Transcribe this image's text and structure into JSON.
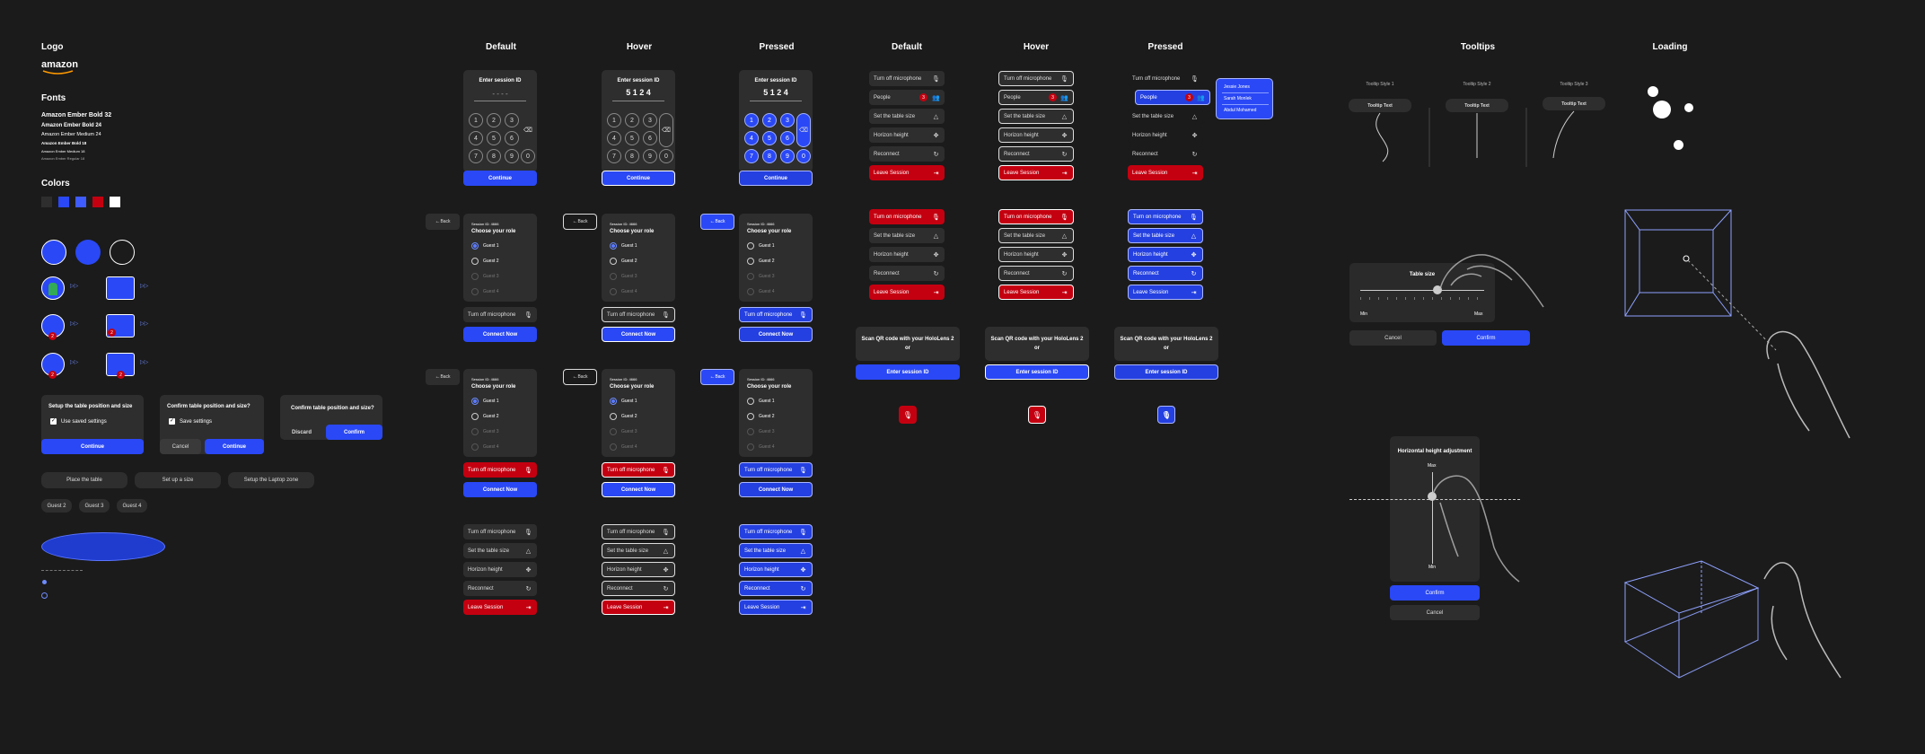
{
  "colors": {
    "background": "#1b1b1b",
    "panel": "#2e2e2e",
    "blue": "#2a48f5",
    "red": "#c40010",
    "white": "#ffffff"
  },
  "styleguide": {
    "logo_title": "Logo",
    "logo_text": "amazon",
    "fonts_title": "Fonts",
    "fonts": [
      "Amazon Ember Bold 32",
      "Amazon Ember Bold 24",
      "Amazon Ember Medium 24",
      "Amazon Ember Bold 18",
      "Amazon Ember Medium 18",
      "Amazon Ember Regular 18"
    ],
    "colors_title": "Colors",
    "swatches": [
      "#2e2e2e",
      "#2a48f5",
      "#3f5cff",
      "#c40010",
      "#ffffff"
    ],
    "badge": "2",
    "confirm_cards": [
      {
        "title": "Setup the table position and size",
        "check": "Use saved settings",
        "primary": "Continue"
      },
      {
        "title": "Confirm table position and size?",
        "check": "Save settings",
        "secondary": "Cancel",
        "primary": "Continue"
      },
      {
        "title": "Confirm table position and size?",
        "secondary": "Discard",
        "primary": "Confirm"
      }
    ],
    "tips": [
      "Place the table",
      "Set up a size",
      "Setup the Laptop zone"
    ],
    "guests": [
      "Guest 2",
      "Guest 3",
      "Guest 4"
    ]
  },
  "headers": {
    "default": "Default",
    "hover": "Hover",
    "pressed": "Pressed",
    "tooltips": "Tooltips",
    "loading": "Loading"
  },
  "keypad": {
    "title": "Enter session ID",
    "empty": "- - - -",
    "code": "5 1 2 4",
    "keys": [
      "1",
      "2",
      "3",
      "4",
      "5",
      "6",
      "7",
      "8",
      "9",
      "0"
    ],
    "backspace": "⌫",
    "continue": "Continue"
  },
  "role": {
    "back": "Back",
    "session": "Session ID: 4666",
    "title": "Choose your role",
    "guests": [
      "Guest 1",
      "Guest 2",
      "Guest 3",
      "Guest 4"
    ],
    "mic": "Turn off microphone",
    "connect": "Connect Now"
  },
  "menu": {
    "items": [
      "Turn off microphone",
      "Set the table size",
      "Horizon height",
      "Reconnect",
      "Leave Session"
    ],
    "items_people": [
      "Turn off microphone",
      "People",
      "Set the table size",
      "Horizon height",
      "Reconnect",
      "Leave Session"
    ],
    "mic_on": "Turn on microphone",
    "people_count": "3",
    "people": [
      "Jessie Jones",
      "Sarah Monlek",
      "Abdul Mohamed"
    ]
  },
  "qr": {
    "text": "Scan QR code with your HoloLens 2",
    "or": "or",
    "button": "Enter session ID"
  },
  "tooltips": {
    "styles": [
      "Tooltip Style 1",
      "Tooltip Style 2",
      "Tooltip Style 3"
    ],
    "text": "Tooltip Text"
  },
  "table_size": {
    "title": "Table size",
    "min": "Min",
    "max": "Max",
    "cancel": "Cancel",
    "confirm": "Confirm"
  },
  "horizon": {
    "title": "Horizontal height adjustment",
    "max": "Max",
    "min": "Min",
    "confirm": "Confirm",
    "cancel": "Cancel"
  }
}
